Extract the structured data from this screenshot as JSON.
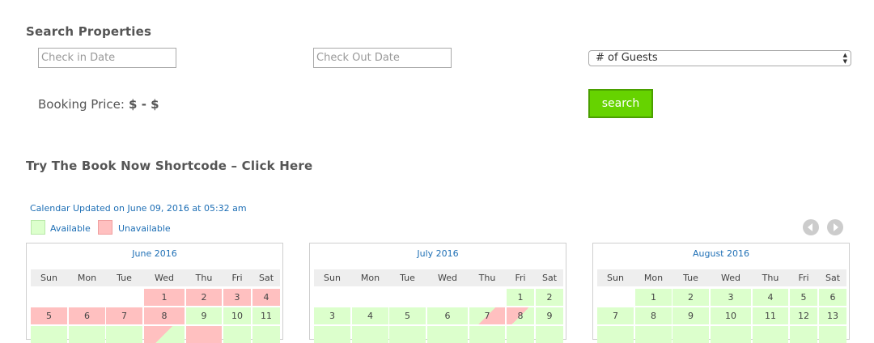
{
  "search": {
    "title": "Search Properties",
    "checkin_placeholder": "Check in Date",
    "checkout_placeholder": "Check Out Date",
    "guests_selected": "# of Guests",
    "price_label": "Booking Price:",
    "price_value": "$ - $",
    "search_button": "search"
  },
  "shortcode": {
    "title": "Try The Book Now Shortcode – Click Here"
  },
  "calendar": {
    "updated": "Calendar Updated on June 09, 2016 at 05:32 am",
    "legend": {
      "available": "Available",
      "unavailable": "Unavailable"
    },
    "colors": {
      "available": "#dcffcc",
      "unavailable": "#ffc0c0",
      "link": "#1e6fb5",
      "button": "#66d300"
    },
    "nav": {
      "prev_icon": "circle-left-arrow-icon",
      "next_icon": "circle-right-arrow-icon"
    },
    "weekdays": [
      "Sun",
      "Mon",
      "Tue",
      "Wed",
      "Thu",
      "Fri",
      "Sat"
    ],
    "months": [
      {
        "title": "June 2016",
        "rows": [
          [
            null,
            null,
            null,
            {
              "d": "1",
              "s": "unavailable"
            },
            {
              "d": "2",
              "s": "unavailable"
            },
            {
              "d": "3",
              "s": "unavailable"
            },
            {
              "d": "4",
              "s": "unavailable"
            }
          ],
          [
            {
              "d": "5",
              "s": "unavailable"
            },
            {
              "d": "6",
              "s": "unavailable"
            },
            {
              "d": "7",
              "s": "unavailable"
            },
            {
              "d": "8",
              "s": "unavailable"
            },
            {
              "d": "9",
              "s": "available"
            },
            {
              "d": "10",
              "s": "available"
            },
            {
              "d": "11",
              "s": "available"
            }
          ],
          [
            {
              "d": "",
              "s": "available"
            },
            {
              "d": "",
              "s": "available"
            },
            {
              "d": "",
              "s": "available"
            },
            {
              "d": "",
              "s": "co-avail"
            },
            {
              "d": "",
              "s": "unavailable"
            },
            {
              "d": "",
              "s": "available"
            },
            {
              "d": "",
              "s": "available"
            }
          ]
        ]
      },
      {
        "title": "July 2016",
        "rows": [
          [
            null,
            null,
            null,
            null,
            null,
            {
              "d": "1",
              "s": "available"
            },
            {
              "d": "2",
              "s": "available"
            }
          ],
          [
            {
              "d": "3",
              "s": "available"
            },
            {
              "d": "4",
              "s": "available"
            },
            {
              "d": "5",
              "s": "available"
            },
            {
              "d": "6",
              "s": "available"
            },
            {
              "d": "7",
              "s": "ci-avail"
            },
            {
              "d": "8",
              "s": "co-avail"
            },
            {
              "d": "9",
              "s": "available"
            }
          ],
          [
            {
              "d": "",
              "s": "available"
            },
            {
              "d": "",
              "s": "available"
            },
            {
              "d": "",
              "s": "available"
            },
            {
              "d": "",
              "s": "available"
            },
            {
              "d": "",
              "s": "available"
            },
            {
              "d": "",
              "s": "available"
            },
            {
              "d": "",
              "s": "available"
            }
          ]
        ]
      },
      {
        "title": "August 2016",
        "rows": [
          [
            null,
            {
              "d": "1",
              "s": "available"
            },
            {
              "d": "2",
              "s": "available"
            },
            {
              "d": "3",
              "s": "available"
            },
            {
              "d": "4",
              "s": "available"
            },
            {
              "d": "5",
              "s": "available"
            },
            {
              "d": "6",
              "s": "available"
            }
          ],
          [
            {
              "d": "7",
              "s": "available"
            },
            {
              "d": "8",
              "s": "available"
            },
            {
              "d": "9",
              "s": "available"
            },
            {
              "d": "10",
              "s": "available"
            },
            {
              "d": "11",
              "s": "available"
            },
            {
              "d": "12",
              "s": "available"
            },
            {
              "d": "13",
              "s": "available"
            }
          ],
          [
            {
              "d": "",
              "s": "available"
            },
            {
              "d": "",
              "s": "available"
            },
            {
              "d": "",
              "s": "available"
            },
            {
              "d": "",
              "s": "available"
            },
            {
              "d": "",
              "s": "available"
            },
            {
              "d": "",
              "s": "available"
            },
            {
              "d": "",
              "s": "available"
            }
          ]
        ]
      }
    ]
  }
}
